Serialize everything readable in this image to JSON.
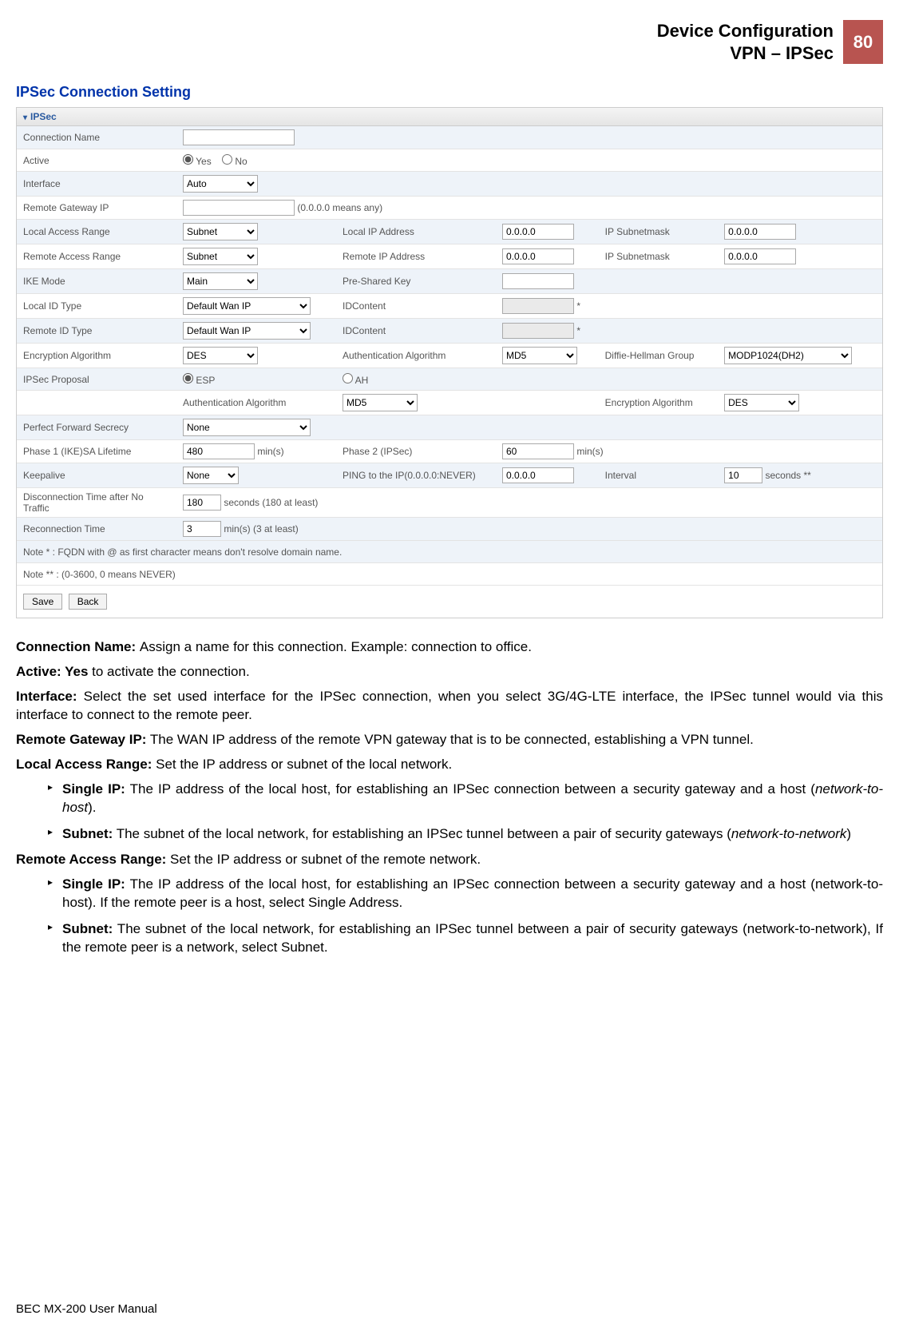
{
  "header": {
    "title1": "Device Configuration",
    "title2": "VPN – IPSec",
    "page": "80"
  },
  "section_title": "IPSec Connection Setting",
  "panel_title": "IPSec",
  "form": {
    "connection_name": {
      "label": "Connection Name",
      "value": ""
    },
    "active": {
      "label": "Active",
      "yes": "Yes",
      "no": "No"
    },
    "interface": {
      "label": "Interface",
      "value": "Auto"
    },
    "remote_gw": {
      "label": "Remote Gateway IP",
      "value": "",
      "hint": "(0.0.0.0 means any)"
    },
    "local_access": {
      "label": "Local Access Range",
      "value": "Subnet",
      "ip_label": "Local IP Address",
      "ip": "0.0.0.0",
      "mask_label": "IP Subnetmask",
      "mask": "0.0.0.0"
    },
    "remote_access": {
      "label": "Remote Access Range",
      "value": "Subnet",
      "ip_label": "Remote IP Address",
      "ip": "0.0.0.0",
      "mask_label": "IP Subnetmask",
      "mask": "0.0.0.0"
    },
    "ike_mode": {
      "label": "IKE Mode",
      "value": "Main",
      "psk_label": "Pre-Shared Key",
      "psk": ""
    },
    "local_id": {
      "label": "Local ID Type",
      "value": "Default Wan IP",
      "content_label": "IDContent",
      "content": "",
      "star": "*"
    },
    "remote_id": {
      "label": "Remote ID Type",
      "value": "Default Wan IP",
      "content_label": "IDContent",
      "content": "",
      "star": "*"
    },
    "enc_algo": {
      "label": "Encryption Algorithm",
      "value": "DES",
      "auth_label": "Authentication Algorithm",
      "auth": "MD5",
      "dh_label": "Diffie-Hellman Group",
      "dh": "MODP1024(DH2)"
    },
    "ipsec_proposal": {
      "label": "IPSec Proposal",
      "esp": "ESP",
      "ah": "AH"
    },
    "proposal_sub": {
      "auth_label": "Authentication Algorithm",
      "auth": "MD5",
      "enc_label": "Encryption Algorithm",
      "enc": "DES"
    },
    "pfs": {
      "label": "Perfect Forward Secrecy",
      "value": "None"
    },
    "phase1": {
      "label": "Phase 1 (IKE)SA Lifetime",
      "value": "480",
      "unit": "min(s)",
      "p2_label": "Phase 2 (IPSec)",
      "p2_value": "60",
      "p2_unit": "min(s)"
    },
    "keepalive": {
      "label": "Keepalive",
      "value": "None",
      "ping_label": "PING to the IP(0.0.0.0:NEVER)",
      "ping": "0.0.0.0",
      "interval_label": "Interval",
      "interval": "10",
      "interval_unit": "seconds **"
    },
    "disc_time": {
      "label": "Disconnection Time after No Traffic",
      "value": "180",
      "unit": "seconds (180 at least)"
    },
    "reconn": {
      "label": "Reconnection Time",
      "value": "3",
      "unit": "min(s) (3 at least)"
    },
    "note1": "Note * : FQDN with @ as first character means don't resolve domain name.",
    "note2": "Note ** : (0-3600, 0 means NEVER)",
    "save": "Save",
    "back": "Back"
  },
  "doc": {
    "p1_b": "Connection Name: ",
    "p1": "Assign a name for this connection. Example: connection to office.",
    "p2_b": "Active: Yes",
    "p2": " to activate the connection.",
    "p3_b": "Interface:",
    "p3": " Select the set used interface for the IPSec connection, when you select 3G/4G-LTE interface, the IPSec tunnel would via this interface to connect to the remote peer.",
    "p4_b": "Remote Gateway IP:",
    "p4": " The WAN IP address of the remote VPN gateway that is to be connected, establishing a VPN tunnel.",
    "p5_b": "Local Access Range:",
    "p5": " Set the IP address or subnet of the local network.",
    "li1_b": "Single IP:",
    "li1": " The IP address of the local host, for establishing an IPSec connection between a security gateway and a host (",
    "li1_i": "network-to-host",
    "li1_end": ").",
    "li2_b": "Subnet:",
    "li2": " The subnet of the local network, for establishing an IPSec tunnel between a pair of security gateways (",
    "li2_i": "network-to-network",
    "li2_end": ")",
    "p6_b": "Remote Access Range:",
    "p6": " Set the IP address or subnet of the remote network.",
    "li3_b": "Single IP:",
    "li3": " The IP address of the local host, for establishing an IPSec connection between a security gateway and a host (network-to-host). If the remote peer is a host, select Single Address.",
    "li4_b": "Subnet:",
    "li4": " The subnet of the local network, for establishing an IPSec tunnel between a pair of security gateways (network-to-network), If the remote peer is a network, select Subnet."
  },
  "footer": "BEC MX-200 User Manual"
}
